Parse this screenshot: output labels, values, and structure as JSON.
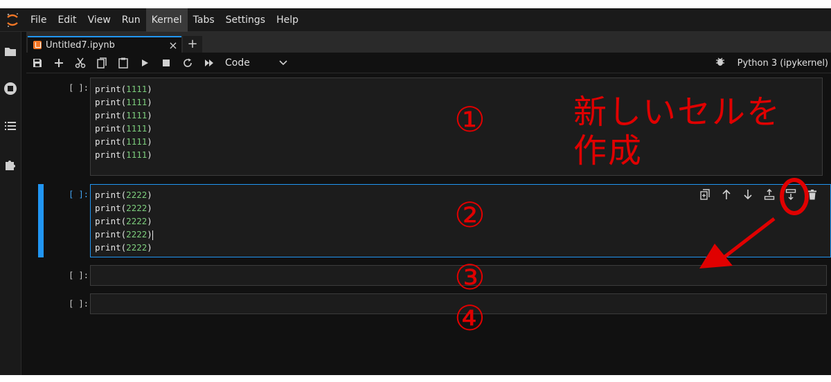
{
  "menubar": {
    "items": [
      {
        "label": "File"
      },
      {
        "label": "Edit"
      },
      {
        "label": "View"
      },
      {
        "label": "Run"
      },
      {
        "label": "Kernel"
      },
      {
        "label": "Tabs"
      },
      {
        "label": "Settings"
      },
      {
        "label": "Help"
      }
    ],
    "active_item": "Kernel"
  },
  "tab": {
    "label": "Untitled7.ipynb",
    "close_glyph": "×",
    "new_tab_glyph": "+"
  },
  "toolbar": {
    "cell_type": "Code",
    "kernel_name": "Python 3 (ipykernel)"
  },
  "cells": [
    {
      "prompt": "[ ]:",
      "lines": [
        "1111",
        "1111",
        "1111",
        "1111",
        "1111",
        "1111"
      ]
    },
    {
      "prompt": "[ ]:",
      "lines": [
        "2222",
        "2222",
        "2222",
        "2222",
        "2222"
      ]
    },
    {
      "prompt": "[ ]:",
      "lines": []
    },
    {
      "prompt": "[ ]:",
      "lines": []
    }
  ],
  "code": {
    "keyword": "print",
    "open": "(",
    "close": ")"
  },
  "annotations": {
    "circled_1": "①",
    "circled_2": "②",
    "circled_3": "③",
    "circled_4": "④",
    "caption_line1": "新しいセルを",
    "caption_line2": "作成"
  },
  "colors": {
    "accent": "#2196f3",
    "annotation": "#e00000",
    "number_literal": "#7ccd7c",
    "jupyter_orange": "#f37726"
  }
}
